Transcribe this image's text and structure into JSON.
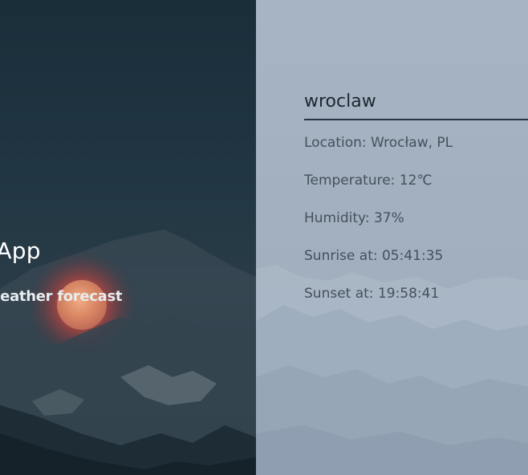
{
  "hero": {
    "title": "ther App",
    "subtitle": "e World weather forecast"
  },
  "search": {
    "value": "wroclaw",
    "placeholder": ""
  },
  "weather": {
    "items": [
      {
        "label": "Location: Wrocław, PL"
      },
      {
        "label": "Temperature: 12℃"
      },
      {
        "label": "Humidity: 37%"
      },
      {
        "label": "Sunrise at: 05:41:35"
      },
      {
        "label": "Sunset at: 19:58:41"
      }
    ]
  },
  "colors": {
    "hero_bg": "#1f3440",
    "panel_bg": "#a4b2c2",
    "text": "#47505b",
    "sun_glow": "#d9483f"
  },
  "icons": {
    "sun": "sun-icon"
  }
}
